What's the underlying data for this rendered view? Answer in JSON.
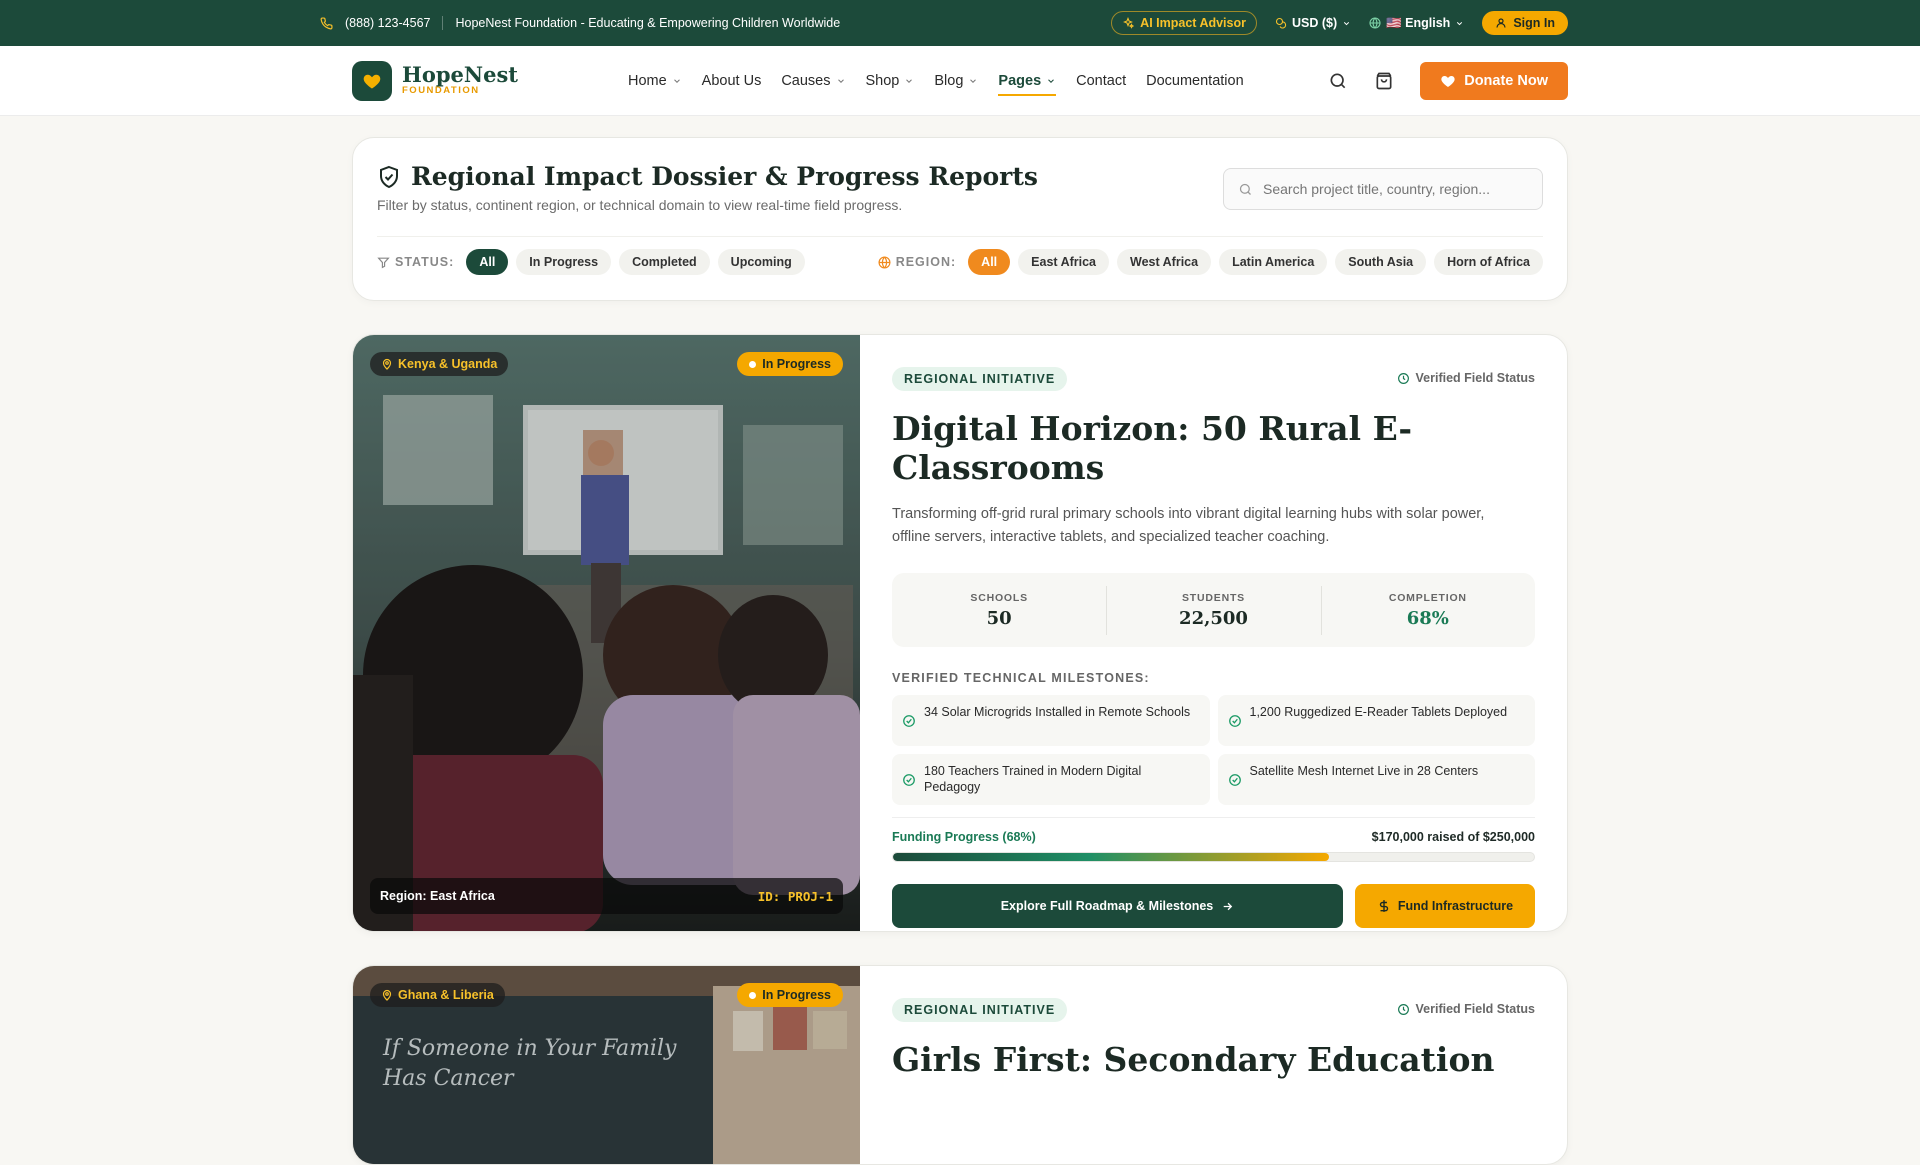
{
  "topbar": {
    "phone": "(888) 123-4567",
    "tagline": "HopeNest Foundation - Educating & Empowering Children Worldwide",
    "ai_advisor": "AI Impact Advisor",
    "currency": "USD ($)",
    "language": "🇺🇸 English",
    "sign_in": "Sign In"
  },
  "brand": {
    "name": "HopeNest",
    "sub": "FOUNDATION"
  },
  "nav": {
    "items": [
      {
        "label": "Home",
        "dropdown": true
      },
      {
        "label": "About Us",
        "dropdown": false
      },
      {
        "label": "Causes",
        "dropdown": true
      },
      {
        "label": "Shop",
        "dropdown": true
      },
      {
        "label": "Blog",
        "dropdown": true
      },
      {
        "label": "Pages",
        "dropdown": true,
        "active": true
      },
      {
        "label": "Contact",
        "dropdown": false
      },
      {
        "label": "Documentation",
        "dropdown": false
      }
    ],
    "donate": "Donate Now"
  },
  "filters": {
    "title": "Regional Impact Dossier & Progress Reports",
    "subtitle": "Filter by status, continent region, or technical domain to view real-time field progress.",
    "search_placeholder": "Search project title, country, region...",
    "status_label": "STATUS:",
    "status_options": [
      "All",
      "In Progress",
      "Completed",
      "Upcoming"
    ],
    "region_label": "REGION:",
    "region_options": [
      "All",
      "East Africa",
      "West Africa",
      "Latin America",
      "South Asia",
      "Horn of Africa"
    ]
  },
  "projects": [
    {
      "location": "Kenya & Uganda",
      "status": "In Progress",
      "region": "Region: East Africa",
      "id": "ID: PROJ-1",
      "tag": "REGIONAL INITIATIVE",
      "verified": "Verified Field Status",
      "title": "Digital Horizon: 50 Rural E-Classrooms",
      "description": "Transforming off-grid rural primary schools into vibrant digital learning hubs with solar power, offline servers, interactive tablets, and specialized teacher coaching.",
      "stats": [
        {
          "label": "SCHOOLS",
          "value": "50"
        },
        {
          "label": "STUDENTS",
          "value": "22,500"
        },
        {
          "label": "COMPLETION",
          "value": "68%"
        }
      ],
      "milestones_label": "VERIFIED TECHNICAL MILESTONES:",
      "milestones": [
        "34 Solar Microgrids Installed in Remote Schools",
        "1,200 Ruggedized E-Reader Tablets Deployed",
        "180 Teachers Trained in Modern Digital Pedagogy",
        "Satellite Mesh Internet Live in 28 Centers"
      ],
      "funding_label": "Funding Progress (68%)",
      "funding_text": "$170,000 raised of $250,000",
      "funding_fraction": 0.68,
      "cta_primary": "Explore Full Roadmap & Milestones",
      "cta_secondary": "Fund Infrastructure"
    },
    {
      "location": "Ghana & Liberia",
      "status": "In Progress",
      "tag": "REGIONAL INITIATIVE",
      "verified": "Verified Field Status",
      "title": "Girls First: Secondary Education",
      "chalk": "If Someone in Your Family Has Cancer"
    }
  ]
}
